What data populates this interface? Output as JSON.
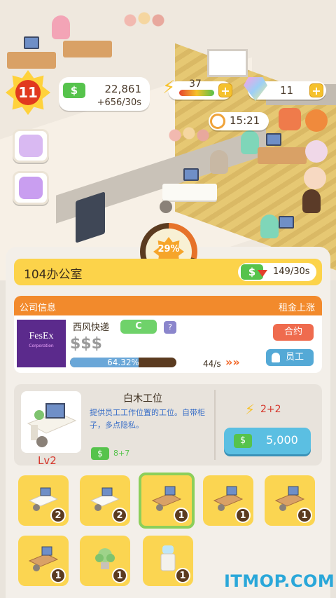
{
  "hud": {
    "level": "11",
    "money": "22,861",
    "money_rate": "+656/30s",
    "energy": "37",
    "gems": "11",
    "timer": "15:21",
    "cash_symbol": "$",
    "plus": "+"
  },
  "office": {
    "progress_pct": "29%",
    "progress_value": 0.29,
    "name": "104办公室",
    "rent_rate": "149/30s"
  },
  "company": {
    "header_left": "公司信息",
    "header_right": "租金上涨",
    "logo_text": "FesEx",
    "logo_sub": "Corporation",
    "name": "西风快递",
    "grade": "C",
    "help": "?",
    "rating": "$$$",
    "progress": "64.32%",
    "progress_value": 0.6432,
    "speed": "44/s",
    "speed_arrows": "»»",
    "contract_label": "合约",
    "staff_label": "员工"
  },
  "item": {
    "title": "白木工位",
    "description": "提供员工工作位置的工位。自带柜子，多点隐私。",
    "level": "Lv2",
    "income": "8+7",
    "energy_gain": "2+2",
    "price": "5,000"
  },
  "grid": [
    {
      "name": "white-desk",
      "count": "2"
    },
    {
      "name": "white-desk",
      "count": "2"
    },
    {
      "name": "wood-desk",
      "count": "1",
      "selected": true
    },
    {
      "name": "wood-desk",
      "count": "1"
    },
    {
      "name": "wood-desk",
      "count": "1"
    },
    {
      "name": "wood-desk",
      "count": "1"
    },
    {
      "name": "plant",
      "count": "1"
    },
    {
      "name": "water-cooler",
      "count": "1"
    }
  ],
  "watermark": "ITMOP.COM",
  "colors": {
    "money_green": "#56c34c",
    "gold": "#fbd551",
    "orange": "#f28a2c",
    "buy_blue": "#5bbfe2"
  }
}
